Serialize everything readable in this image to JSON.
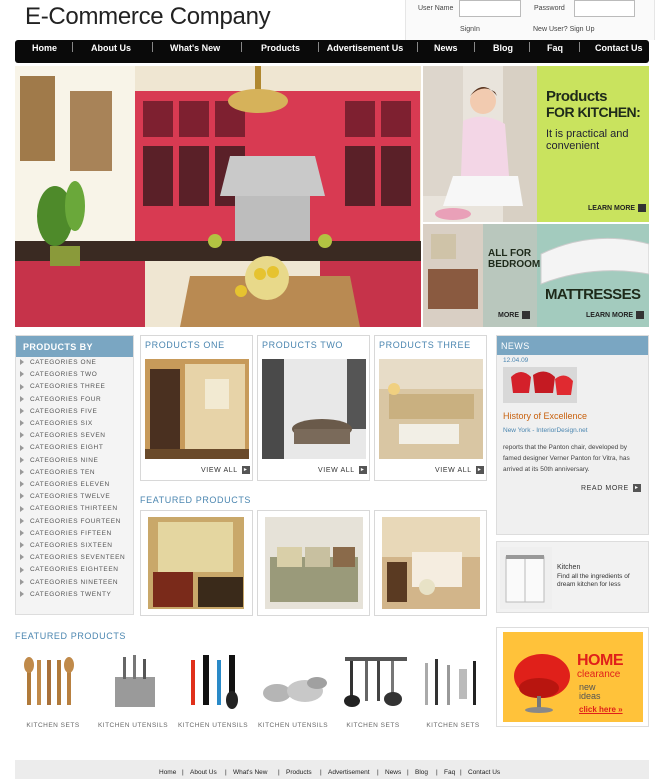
{
  "header": {
    "logo": "E-Commerce Company",
    "user_label": "User Name",
    "password_label": "Password",
    "signin": "SignIn",
    "signup": "New User? Sign Up"
  },
  "nav": [
    "Home",
    "About Us",
    "What's New",
    "Products",
    "Advertisement Us",
    "News",
    "Blog",
    "Faq",
    "Contact Us"
  ],
  "promo1": {
    "title1": "Products",
    "title2": "FOR KITCHEN:",
    "body": "It is practical and convenient",
    "more": "LEARN MORE"
  },
  "promo2": {
    "bedroom": "ALL FOR BEDROOM",
    "more": "MORE",
    "mattress": "MATTRESSES",
    "learn": "LEARN MORE"
  },
  "sidebar": {
    "title": "PRODUCTS BY",
    "categories": [
      "CATEGORIES ONE",
      "CATEGORIES TWO",
      "CATEGORIES THREE",
      "CATEGORIES FOUR",
      "CATEGORIES FIVE",
      "CATEGORIES SIX",
      "CATEGORIES SEVEN",
      "CATEGORIES EIGHT",
      "CATEGORIES NINE",
      "CATEGORIES TEN",
      "CATEGORIES ELEVEN",
      "CATEGORIES TWELVE",
      "CATEGORIES THIRTEEN",
      "CATEGORIES FOURTEEN",
      "CATEGORIES FIFTEEN",
      "CATEGORIES SIXTEEN",
      "CATEGORIES SEVENTEEN",
      "CATEGORIES EIGHTEEN",
      "CATEGORIES NINETEEN",
      "CATEGORIES TWENTY"
    ]
  },
  "products": {
    "one": "PRODUCTS ONE",
    "two": "PRODUCTS TWO",
    "three": "PRODUCTS THREE",
    "view_all": "VIEW ALL"
  },
  "featured_title": "FEATURED PRODUCTS",
  "news": {
    "title": "NEWS",
    "date": "12.04.09",
    "headline": "History of Excellence",
    "source": "New York - InteriorDesign.net",
    "body": "reports that the Panton chair, developed by famed designer Verner Panton for Vitra, has arrived at its 50th anniversary.",
    "read_more": "READ MORE"
  },
  "kitchen_ad": {
    "title": "Kitchen",
    "body": "Find all the ingredients of dream kitchen for less"
  },
  "home_ad": {
    "line1": "HOME",
    "line2": "clearance",
    "line3": "new",
    "line4": "ideas",
    "cta": "click here »"
  },
  "featured_bottom": {
    "title": "FEATURED PRODUCTS",
    "labels": [
      "KITCHEN SETS",
      "KITCHEN UTENSILS",
      "KITCHEN UTENSILS",
      "KITCHEN UTENSILS",
      "KITCHEN SETS",
      "KITCHEN SETS"
    ]
  },
  "footer": [
    "Home",
    "About Us",
    "What's New",
    "Products",
    "Advertisement",
    "News",
    "Blog",
    "Faq",
    "Contact Us"
  ],
  "colors": {
    "accent": "#7aa6c2",
    "link": "#4b86b0",
    "news_headline": "#c8610e",
    "promo_green": "#c7e35a",
    "mattress_bg": "#9fc9ba"
  }
}
